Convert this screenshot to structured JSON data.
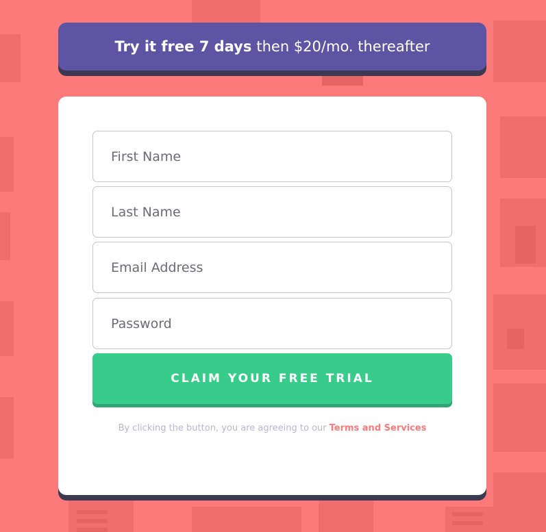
{
  "promo": {
    "bold_text": "Try it free 7 days",
    "rest_text": "then $20/mo. thereafter"
  },
  "form": {
    "first_name_placeholder": "First Name",
    "last_name_placeholder": "Last Name",
    "email_placeholder": "Email Address",
    "password_placeholder": "Password",
    "submit_label": "CLAIM YOUR FREE TRIAL",
    "terms_text": "By clicking the button, you are agreeing to our",
    "terms_link": "Terms and Services"
  },
  "colors": {
    "background": "#fd7a7a",
    "promo_bg": "#5e54a4",
    "button_green": "#38cc8b",
    "link_red": "#ff7a7a"
  }
}
